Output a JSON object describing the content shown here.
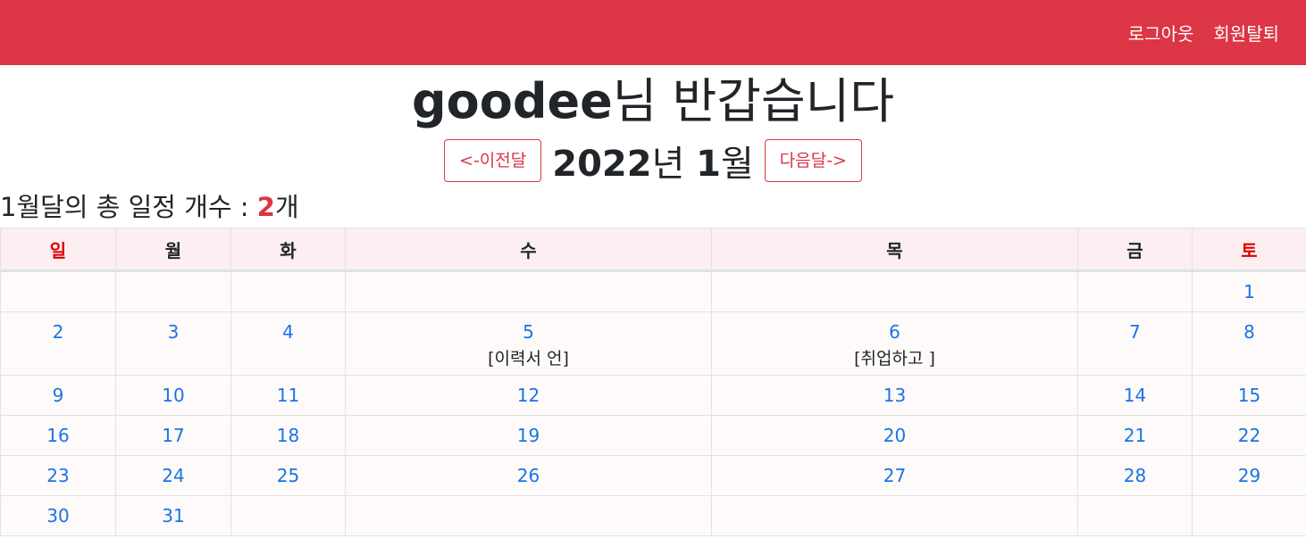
{
  "nav": {
    "logout_label": "로그아웃",
    "withdraw_label": "회원탈퇴",
    "bg_color": "#dc3545"
  },
  "greeting": {
    "user": "goodee",
    "suffix": "님 반갑습니다"
  },
  "month": {
    "prev_label": "<-이전달",
    "year": "2022",
    "year_unit": "년 ",
    "month": "1",
    "month_unit": "월",
    "next_label": "다음달->"
  },
  "summary": {
    "month": "1",
    "text": "월달의 총 일정 개수 : ",
    "count": "2",
    "unit": "개"
  },
  "calendar": {
    "weekdays": [
      "일",
      "월",
      "화",
      "수",
      "목",
      "금",
      "토"
    ],
    "weeks": [
      [
        {
          "day": ""
        },
        {
          "day": ""
        },
        {
          "day": ""
        },
        {
          "day": ""
        },
        {
          "day": ""
        },
        {
          "day": ""
        },
        {
          "day": "1"
        }
      ],
      [
        {
          "day": "2"
        },
        {
          "day": "3"
        },
        {
          "day": "4"
        },
        {
          "day": "5",
          "event": "[이력서 언]"
        },
        {
          "day": "6",
          "event": "[취업하고 ]"
        },
        {
          "day": "7"
        },
        {
          "day": "8"
        }
      ],
      [
        {
          "day": "9"
        },
        {
          "day": "10"
        },
        {
          "day": "11"
        },
        {
          "day": "12"
        },
        {
          "day": "13"
        },
        {
          "day": "14"
        },
        {
          "day": "15"
        }
      ],
      [
        {
          "day": "16"
        },
        {
          "day": "17"
        },
        {
          "day": "18"
        },
        {
          "day": "19"
        },
        {
          "day": "20"
        },
        {
          "day": "21"
        },
        {
          "day": "22"
        }
      ],
      [
        {
          "day": "23"
        },
        {
          "day": "24"
        },
        {
          "day": "25"
        },
        {
          "day": "26"
        },
        {
          "day": "27"
        },
        {
          "day": "28"
        },
        {
          "day": "29"
        }
      ],
      [
        {
          "day": "30"
        },
        {
          "day": "31"
        },
        {
          "day": ""
        },
        {
          "day": ""
        },
        {
          "day": ""
        },
        {
          "day": ""
        },
        {
          "day": ""
        }
      ]
    ]
  }
}
